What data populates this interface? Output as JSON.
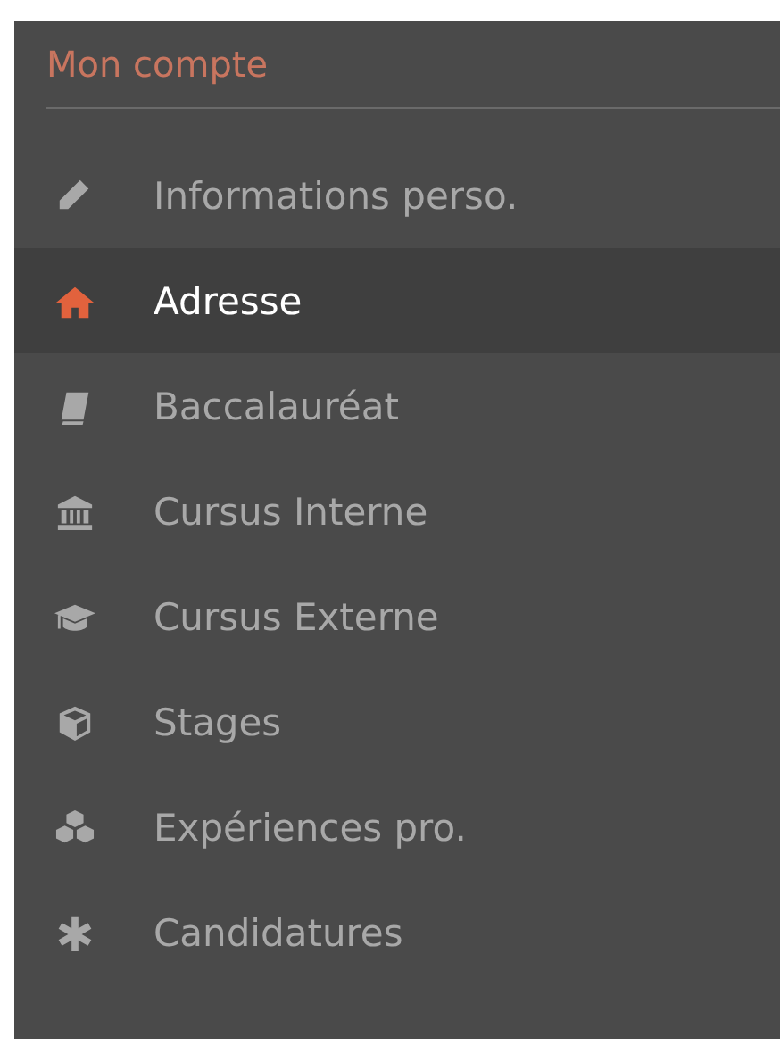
{
  "sidebar": {
    "title": "Mon compte",
    "items": [
      {
        "label": "Informations perso.",
        "kind": "pencil",
        "selected": false
      },
      {
        "label": "Adresse",
        "kind": "home",
        "selected": true
      },
      {
        "label": "Baccalauréat",
        "kind": "book",
        "selected": false
      },
      {
        "label": "Cursus Interne",
        "kind": "bank",
        "selected": false
      },
      {
        "label": "Cursus Externe",
        "kind": "cap",
        "selected": false
      },
      {
        "label": "Stages",
        "kind": "cube",
        "selected": false
      },
      {
        "label": "Expériences pro.",
        "kind": "cubes",
        "selected": false
      },
      {
        "label": "Candidatures",
        "kind": "asterisk",
        "selected": false
      }
    ]
  }
}
